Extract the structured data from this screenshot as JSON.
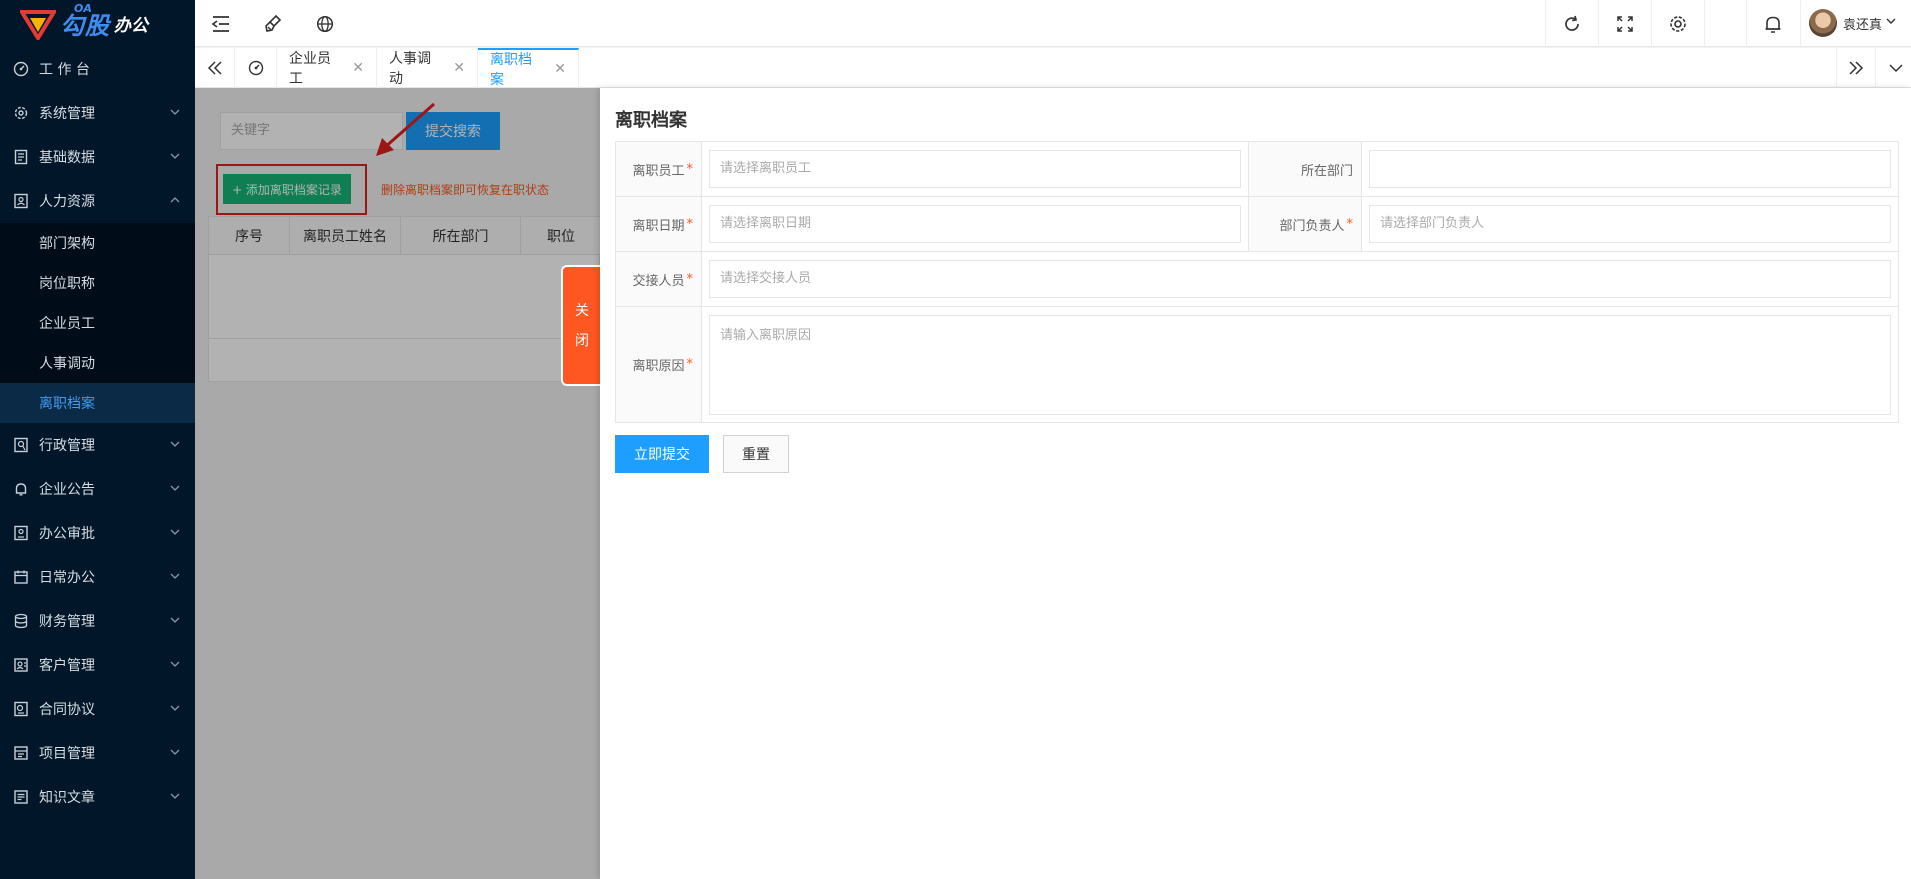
{
  "app": {
    "logo_oa": "OA",
    "brand_main": "勾股",
    "brand_sub": "办公"
  },
  "sidebar": {
    "items": [
      {
        "label": "工 作 台",
        "icon": "dashboard-icon",
        "has_children": false
      },
      {
        "label": "系统管理",
        "icon": "gear-icon",
        "has_children": true
      },
      {
        "label": "基础数据",
        "icon": "document-icon",
        "has_children": true
      },
      {
        "label": "人力资源",
        "icon": "user-card-icon",
        "has_children": true,
        "open": true
      },
      {
        "label": "行政管理",
        "icon": "admin-icon",
        "has_children": true
      },
      {
        "label": "企业公告",
        "icon": "bell-icon",
        "has_children": true
      },
      {
        "label": "办公审批",
        "icon": "approval-icon",
        "has_children": true
      },
      {
        "label": "日常办公",
        "icon": "calendar-icon",
        "has_children": true
      },
      {
        "label": "财务管理",
        "icon": "database-icon",
        "has_children": true
      },
      {
        "label": "客户管理",
        "icon": "customer-icon",
        "has_children": true
      },
      {
        "label": "合同协议",
        "icon": "contract-icon",
        "has_children": true
      },
      {
        "label": "项目管理",
        "icon": "project-icon",
        "has_children": true
      },
      {
        "label": "知识文章",
        "icon": "article-icon",
        "has_children": true
      }
    ],
    "hr_subitems": [
      {
        "label": "部门架构"
      },
      {
        "label": "岗位职称"
      },
      {
        "label": "企业员工"
      },
      {
        "label": "人事调动"
      },
      {
        "label": "离职档案",
        "active": true
      }
    ]
  },
  "header": {
    "user_name": "袁还真"
  },
  "tabs": [
    {
      "label": "企业员工",
      "closable": true
    },
    {
      "label": "人事调动",
      "closable": true
    },
    {
      "label": "离职档案",
      "closable": true,
      "active": true
    }
  ],
  "list": {
    "search_placeholder": "关键字",
    "search_button": "提交搜索",
    "add_button": "+ 添加离职档案记录",
    "hint": "删除离职档案即可恢复在职状态",
    "columns": [
      "序号",
      "离职员工姓名",
      "所在部门",
      "职位"
    ]
  },
  "close_tab": {
    "chars": [
      "关",
      "闭"
    ]
  },
  "form": {
    "title": "离职档案",
    "employee_label": "离职员工",
    "employee_placeholder": "请选择离职员工",
    "department_label": "所在部门",
    "department_value": "",
    "date_label": "离职日期",
    "date_placeholder": "请选择离职日期",
    "leader_label": "部门负责人",
    "leader_placeholder": "请选择部门负责人",
    "handover_label": "交接人员",
    "handover_placeholder": "请选择交接人员",
    "reason_label": "离职原因",
    "reason_placeholder": "请输入离职原因",
    "required_mark": "*",
    "submit_button": "立即提交",
    "reset_button": "重置"
  },
  "colors": {
    "sidebar_bg": "#011628",
    "primary": "#1e9fff",
    "success": "#16b777",
    "danger": "#ff5722",
    "highlight_box": "#e02020"
  }
}
